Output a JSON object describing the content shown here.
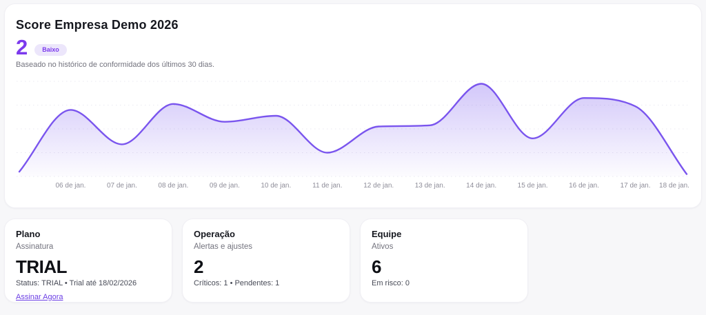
{
  "theme": {
    "accent": "#7c3aed",
    "badge_bg": "#ece6fb",
    "page_bg": "#f7f7f9",
    "panel_bg": "#ffffff"
  },
  "score_panel": {
    "title": "Score Empresa Demo 2026",
    "score_value": "2",
    "badge_label": "Baixo",
    "subtitle": "Baseado no histórico de conformidade dos últimos 30 dias."
  },
  "chart_data": {
    "type": "area",
    "title": "Score Empresa Demo 2026",
    "x_labels": [
      "06 de jan.",
      "07 de jan.",
      "08 de jan.",
      "09 de jan.",
      "10 de jan.",
      "11 de jan.",
      "12 de jan.",
      "13 de jan.",
      "14 de jan.",
      "15 de jan.",
      "16 de jan.",
      "17 de jan.",
      "18 de jan."
    ],
    "values": [
      0.2,
      2.8,
      1.35,
      3.05,
      2.3,
      2.55,
      1.0,
      2.1,
      2.15,
      3.9,
      1.6,
      3.3,
      2.95,
      0.1
    ],
    "first_point_unlabeled": true,
    "ylim": [
      0,
      4
    ],
    "grid": "horizontal-dotted",
    "gridline_count": 5,
    "legend": "none",
    "line_color": "#7a55ee",
    "fill_top": "rgba(124,92,238,0.34)",
    "fill_bottom": "rgba(124,92,238,0.02)",
    "curve": "monotone"
  },
  "cards": [
    {
      "title": "Plano",
      "subtitle": "Assinatura",
      "value": "TRIAL",
      "detail": "Status: TRIAL • Trial até 18/02/2026",
      "link": "Assinar Agora"
    },
    {
      "title": "Operação",
      "subtitle": "Alertas e ajustes",
      "value": "2",
      "detail": "Críticos: 1 • Pendentes: 1"
    },
    {
      "title": "Equipe",
      "subtitle": "Ativos",
      "value": "6",
      "detail": "Em risco: 0"
    }
  ]
}
